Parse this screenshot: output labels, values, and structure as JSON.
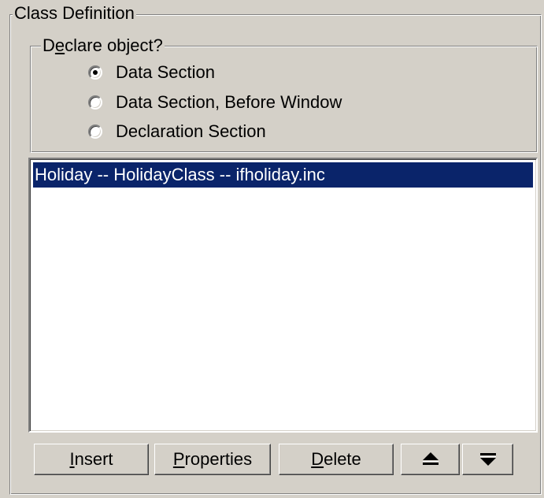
{
  "class_definition": {
    "title": "Class Definition",
    "declare": {
      "title_prefix": "D",
      "title_access": "e",
      "title_suffix": "clare object?",
      "options": [
        {
          "label": "Data Section",
          "checked": true
        },
        {
          "label": "Data Section, Before Window",
          "checked": false
        },
        {
          "label": "Declaration Section",
          "checked": false
        }
      ]
    },
    "list": {
      "items": [
        "Holiday -- HolidayClass -- ifholiday.inc"
      ],
      "selected_index": 0
    },
    "buttons": {
      "insert": {
        "access": "I",
        "rest": "nsert"
      },
      "properties": {
        "access": "P",
        "rest": "roperties"
      },
      "delete": {
        "access": "D",
        "rest": "elete"
      },
      "move_up_icon": "arrow-up-icon",
      "move_down_icon": "arrow-down-icon"
    }
  },
  "colors": {
    "face": "#d4d0c8",
    "selection": "#0a246a"
  }
}
